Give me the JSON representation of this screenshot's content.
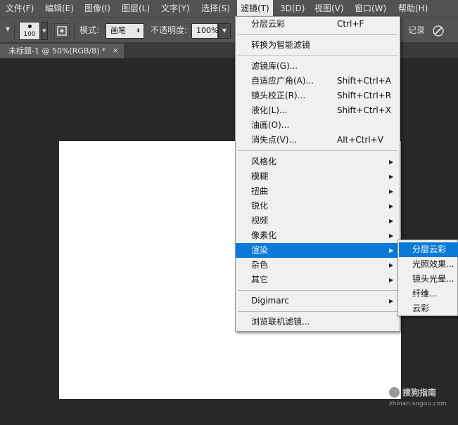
{
  "menubar": {
    "items": [
      "文件(F)",
      "编辑(E)",
      "图像(I)",
      "图层(L)",
      "文字(Y)",
      "选择(S)",
      "滤镜(T)",
      "3D(D)",
      "视图(V)",
      "窗口(W)",
      "帮助(H)"
    ],
    "active": "滤镜(T)"
  },
  "options": {
    "brush_size": "100",
    "mode_label": "模式:",
    "mode_value": "画笔",
    "opacity_label": "不透明度:",
    "opacity_value": "100%",
    "history_label": "记录"
  },
  "document_tab": {
    "title": "未标题-1 @ 50%(RGB/8) *",
    "close": "×"
  },
  "filter_menu": {
    "items": [
      {
        "label": "分层云彩",
        "shortcut": "Ctrl+F"
      },
      {
        "label": "转换为智能滤镜"
      },
      {
        "label": "滤镜库(G)..."
      },
      {
        "label": "自适应广角(A)...",
        "shortcut": "Shift+Ctrl+A"
      },
      {
        "label": "镜头校正(R)...",
        "shortcut": "Shift+Ctrl+R"
      },
      {
        "label": "液化(L)...",
        "shortcut": "Shift+Ctrl+X"
      },
      {
        "label": "油画(O)..."
      },
      {
        "label": "消失点(V)...",
        "shortcut": "Alt+Ctrl+V"
      },
      {
        "label": "风格化",
        "submenu": true
      },
      {
        "label": "模糊",
        "submenu": true
      },
      {
        "label": "扭曲",
        "submenu": true
      },
      {
        "label": "锐化",
        "submenu": true
      },
      {
        "label": "视频",
        "submenu": true
      },
      {
        "label": "像素化",
        "submenu": true
      },
      {
        "label": "渲染",
        "submenu": true,
        "highlighted": true
      },
      {
        "label": "杂色",
        "submenu": true
      },
      {
        "label": "其它",
        "submenu": true
      },
      {
        "label": "Digimarc",
        "submenu": true
      },
      {
        "label": "浏览联机滤镜..."
      }
    ],
    "submenu_arrow": "▶"
  },
  "render_submenu": {
    "items": [
      {
        "label": "分层云彩",
        "highlighted": true
      },
      {
        "label": "光照效果..."
      },
      {
        "label": "镜头光晕..."
      },
      {
        "label": "纤维..."
      },
      {
        "label": "云彩"
      }
    ]
  },
  "watermark": {
    "name": "搜狗指南",
    "url": "zhinan.sogou.com"
  },
  "colors": {
    "accent": "#0a7ad6",
    "panel": "#535353",
    "workspace": "#282828"
  }
}
